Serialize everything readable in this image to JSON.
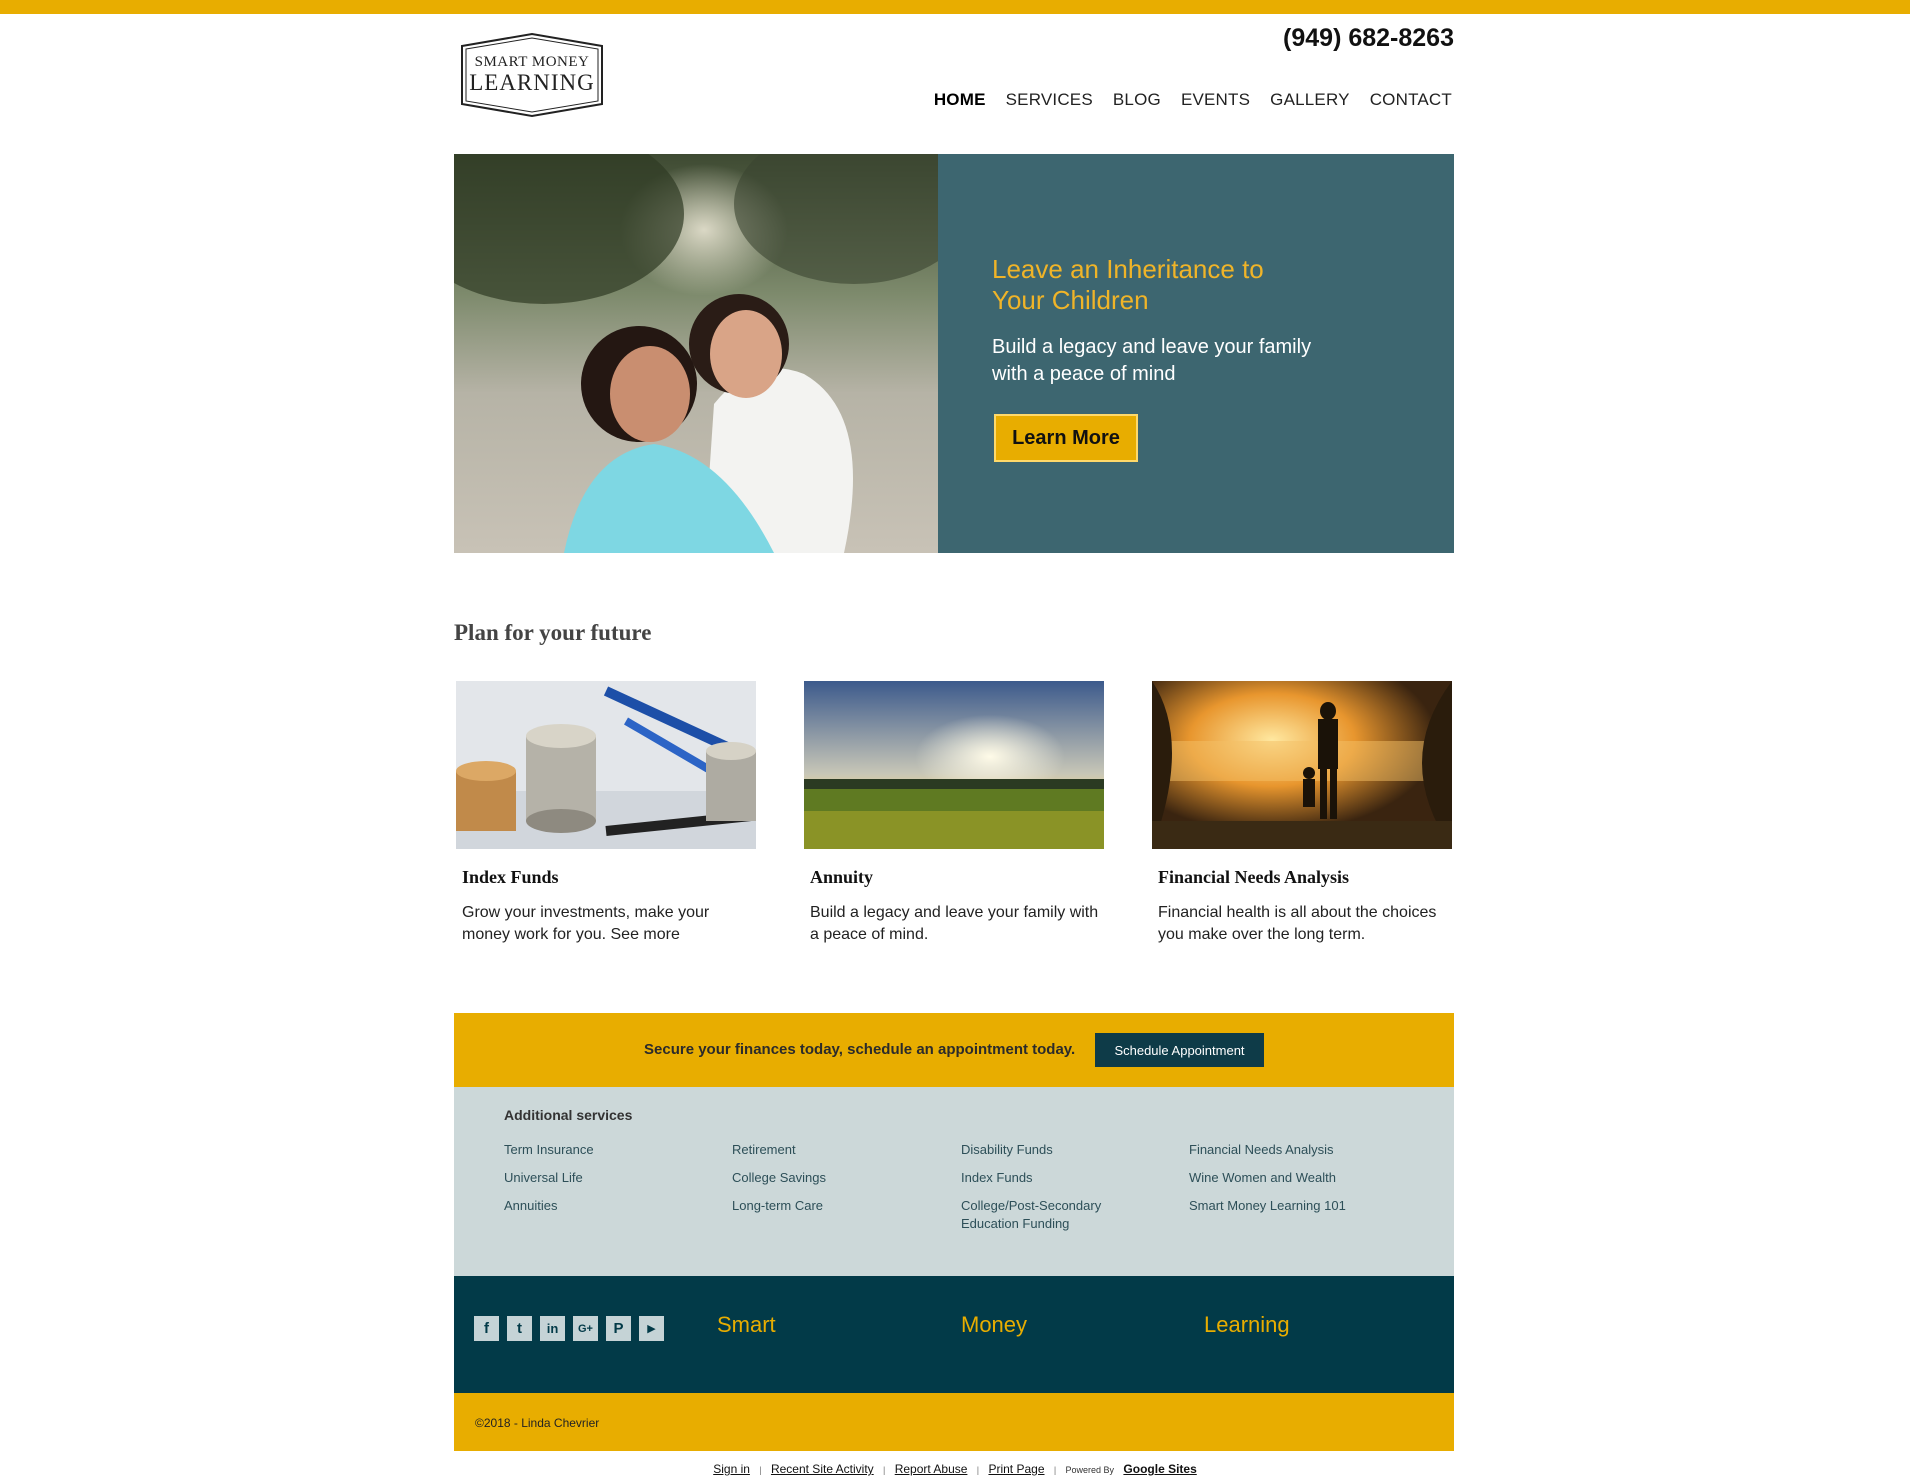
{
  "header": {
    "logo_top": "SMART MONEY",
    "logo_bottom": "LEARNING",
    "phone": "(949) 682-8263",
    "nav": [
      "HOME",
      "SERVICES",
      "BLOG",
      "EVENTS",
      "GALLERY",
      "CONTACT"
    ],
    "active_nav": "HOME"
  },
  "hero": {
    "title": "Leave an Inheritance to Your Children",
    "subtitle": "Build a legacy and leave your family with a peace of mind",
    "button": "Learn More"
  },
  "plan": {
    "title": "Plan for your future",
    "cards": [
      {
        "title": "Index Funds",
        "text": "Grow your investments, make your money work for you. See more"
      },
      {
        "title": "Annuity",
        "text": "Build a legacy and leave your family with a peace of mind."
      },
      {
        "title": "Financial Needs Analysis",
        "text": "Financial health is all about the choices you make over the long term."
      }
    ]
  },
  "cta": {
    "text": "Secure your finances today, schedule an appointment today.",
    "button": "Schedule Appointment"
  },
  "services": {
    "title": "Additional services",
    "columns": [
      [
        "Term Insurance",
        "Universal Life",
        "Annuities"
      ],
      [
        "Retirement",
        "College Savings",
        "Long-term Care"
      ],
      [
        "Disability Funds",
        "Index Funds",
        "College/Post-Secondary Education Funding"
      ],
      [
        "Financial Needs Analysis",
        "Wine Women and Wealth",
        "Smart Money Learning 101"
      ]
    ]
  },
  "footer": {
    "social": [
      "facebook-icon",
      "twitter-icon",
      "linkedin-icon",
      "google-plus-icon",
      "pinterest-icon",
      "youtube-icon"
    ],
    "social_glyphs": [
      "f",
      "t",
      "in",
      "G+",
      "P",
      "▶"
    ],
    "words": [
      "Smart",
      "Money",
      "Learning"
    ],
    "copyright": "©2018 - Linda Chevrier"
  },
  "bottom_links": {
    "sign_in": "Sign in",
    "recent": "Recent Site Activity",
    "report": "Report Abuse",
    "print": "Print Page",
    "powered": "Powered By",
    "google_sites": "Google Sites",
    "separator": "|"
  },
  "colors": {
    "accent": "#e8ad00",
    "hero_panel": "#3d6670",
    "dark_footer": "#023a48",
    "services_bg": "#ccd8d9"
  }
}
